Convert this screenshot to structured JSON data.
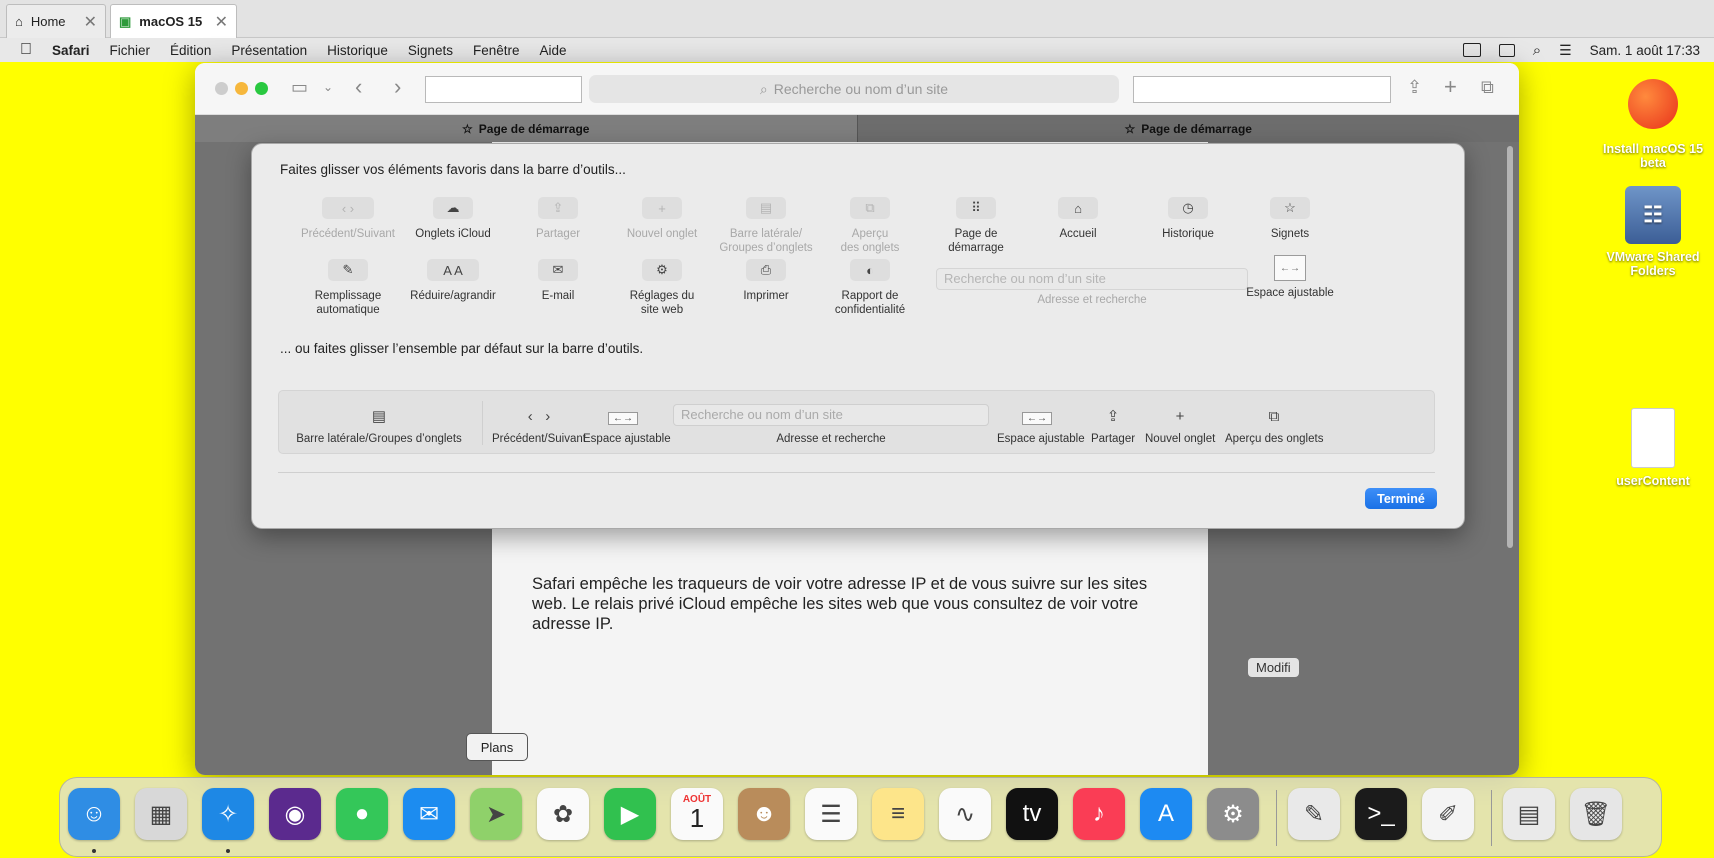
{
  "host": {
    "tabs": [
      {
        "label": "Home",
        "icon": "home-icon",
        "active": false
      },
      {
        "label": "macOS 15",
        "icon": "vm-icon",
        "active": true
      }
    ],
    "close_glyph": "✕"
  },
  "menubar": {
    "apple": "",
    "items": [
      "Safari",
      "Fichier",
      "Édition",
      "Présentation",
      "Historique",
      "Signets",
      "Fenêtre",
      "Aide"
    ],
    "clock": "Sam. 1 août  17:33"
  },
  "safari": {
    "address_placeholder": "Recherche ou nom d’un site",
    "tabs": [
      {
        "label": "Page de démarrage"
      },
      {
        "label": "Page de démarrage"
      }
    ],
    "page_text": "Safari empêche les traqueurs de voir votre adresse IP et de vous suivre sur les sites web. Le relais privé iCloud empêche les sites web que vous consultez de voir votre adresse IP.",
    "modify_label": "Modifi"
  },
  "customize": {
    "heading_items": "Faites glisser vos éléments favoris dans la barre d’outils...",
    "heading_default": "... ou faites glisser l’ensemble par défaut sur la barre d’outils.",
    "row1": [
      {
        "label": "Précédent/Suivant",
        "glyph": "‹ ›",
        "dim": true
      },
      {
        "label": "Onglets iCloud",
        "glyph": "☁",
        "dim": false
      },
      {
        "label": "Partager",
        "glyph": "⇪",
        "dim": true
      },
      {
        "label": "Nouvel onglet",
        "glyph": "+",
        "dim": true
      },
      {
        "label": "Barre latérale/\nGroupes d’onglets",
        "glyph": "▤",
        "dim": true
      },
      {
        "label": "Aperçu\ndes onglets",
        "glyph": "⧉",
        "dim": true
      },
      {
        "label": "Page de\ndémarrage",
        "glyph": "⠿",
        "dim": false
      },
      {
        "label": "Accueil",
        "glyph": "⌂",
        "dim": false
      },
      {
        "label": "Historique",
        "glyph": "◷",
        "dim": false
      },
      {
        "label": "Signets",
        "glyph": "☆",
        "dim": false
      }
    ],
    "row2": [
      {
        "label": "Remplissage\nautomatique",
        "glyph": "✎",
        "dim": false
      },
      {
        "label": "Réduire/agrandir",
        "glyph": "A A",
        "dim": false
      },
      {
        "label": "E-mail",
        "glyph": "✉",
        "dim": false
      },
      {
        "label": "Réglages du\nsite web",
        "glyph": "⚙",
        "dim": false
      },
      {
        "label": "Imprimer",
        "glyph": "⎙",
        "dim": false
      },
      {
        "label": "Rapport de\nconfidentialité",
        "glyph": "◐",
        "dim": false
      }
    ],
    "search_placeholder": "Recherche ou nom d’un site",
    "search_label": "Adresse et recherche",
    "flex_label": "Espace ajustable",
    "default_set": {
      "sidebar": "Barre latérale/Groupes d’onglets",
      "backforward": "Précédent/Suivant",
      "flex1": "Espace ajustable",
      "search_placeholder": "Recherche ou nom d’un site",
      "search": "Adresse et recherche",
      "flex2": "Espace ajustable",
      "share": "Partager",
      "newtab": "Nouvel onglet",
      "overview": "Aperçu des onglets"
    },
    "done": "Terminé"
  },
  "desktop": [
    {
      "label": "Install macOS 15 beta",
      "icon": "macos-installer-icon"
    },
    {
      "label": "VMware Shared Folders",
      "icon": "shared-folders-icon"
    },
    {
      "label": "userContent",
      "icon": "document-icon"
    }
  ],
  "tooltip": "Plans",
  "dock": {
    "apps": [
      {
        "name": "finder",
        "glyph": "☺",
        "color": "#2f8de4",
        "running": true
      },
      {
        "name": "launchpad",
        "glyph": "▦",
        "color": "#d8d8d8",
        "running": false
      },
      {
        "name": "safari",
        "glyph": "✧",
        "color": "#1e88e5",
        "running": true
      },
      {
        "name": "firefox",
        "glyph": "◉",
        "color": "#5b2a8e",
        "running": false
      },
      {
        "name": "messages",
        "glyph": "●",
        "color": "#34c759",
        "running": false
      },
      {
        "name": "mail",
        "glyph": "✉",
        "color": "#1c8cf0",
        "running": false
      },
      {
        "name": "maps",
        "glyph": "➤",
        "color": "#8fd16a",
        "running": false
      },
      {
        "name": "photos",
        "glyph": "✿",
        "color": "#fafafa",
        "running": false
      },
      {
        "name": "facetime",
        "glyph": "▶",
        "color": "#31c14f",
        "running": false
      },
      {
        "name": "calendar",
        "glyph": "1",
        "color": "#fafafa",
        "running": false
      },
      {
        "name": "contacts",
        "glyph": "☻",
        "color": "#b98c5b",
        "running": false
      },
      {
        "name": "reminders",
        "glyph": "☰",
        "color": "#fafafa",
        "running": false
      },
      {
        "name": "notes",
        "glyph": "≡",
        "color": "#fde58a",
        "running": false
      },
      {
        "name": "freeform",
        "glyph": "∿",
        "color": "#fafafa",
        "running": false
      },
      {
        "name": "tv",
        "glyph": "tv",
        "color": "#111111",
        "running": false
      },
      {
        "name": "music",
        "glyph": "♪",
        "color": "#fa3d55",
        "running": false
      },
      {
        "name": "app-store",
        "glyph": "A",
        "color": "#1d8af2",
        "running": false
      },
      {
        "name": "system-settings",
        "glyph": "⚙",
        "color": "#8c8c8c",
        "running": false
      },
      {
        "name": "script-editor",
        "glyph": "✎",
        "color": "#e9e9e9",
        "running": false
      },
      {
        "name": "terminal",
        "glyph": ">_",
        "color": "#1b1b1b",
        "running": false
      },
      {
        "name": "textedit",
        "glyph": "✐",
        "color": "#f4f4f4",
        "running": false
      },
      {
        "name": "downloads",
        "glyph": "▤",
        "color": "#eaeaea",
        "running": false
      },
      {
        "name": "trash",
        "glyph": "🗑",
        "color": "#e6e6e6",
        "running": false
      }
    ],
    "calendar_month": "AOÛT",
    "calendar_day": "1"
  },
  "colors": {
    "desktop": "#ffff00",
    "accent": "#1a71e6",
    "close": "#c8c8c8",
    "minimize": "#f6b73c",
    "zoom": "#29c840"
  }
}
